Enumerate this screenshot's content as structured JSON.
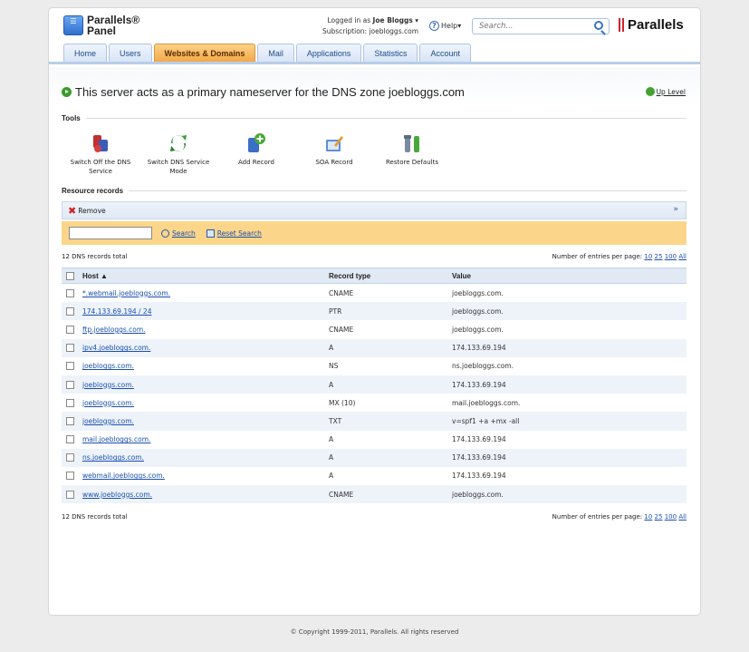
{
  "header": {
    "logo_line1": "Parallels®",
    "logo_line2": "Panel",
    "logged_in_prefix": "Logged in as",
    "user": "Joe Bloggs",
    "subscription": "Subscription: joebloggs.com",
    "help_label": "Help",
    "search_placeholder": "Search...",
    "brand": "Parallels"
  },
  "tabs": [
    {
      "label": "Home"
    },
    {
      "label": "Users"
    },
    {
      "label": "Websites & Domains"
    },
    {
      "label": "Mail"
    },
    {
      "label": "Applications"
    },
    {
      "label": "Statistics"
    },
    {
      "label": "Account"
    }
  ],
  "page": {
    "title": "This server acts as a primary nameserver for the DNS zone joebloggs.com",
    "up_level": "Up Level"
  },
  "tools": {
    "section_label": "Tools",
    "items": [
      {
        "label": "Switch Off the DNS Service",
        "icon": "switch-off-dns-icon"
      },
      {
        "label": "Switch DNS Service Mode",
        "icon": "switch-mode-icon"
      },
      {
        "label": "Add Record",
        "icon": "add-record-icon"
      },
      {
        "label": "SOA Record",
        "icon": "soa-record-icon"
      },
      {
        "label": "Restore Defaults",
        "icon": "restore-defaults-icon"
      }
    ]
  },
  "records": {
    "section_label": "Resource records",
    "remove_label": "Remove",
    "search_label": "Search",
    "reset_search_label": "Reset Search",
    "total": "12 DNS records total",
    "entries_label": "Number of entries per page:",
    "page_sizes": [
      "10",
      "25",
      "100",
      "All"
    ],
    "columns": {
      "host": "Host ▲",
      "type": "Record type",
      "value": "Value"
    },
    "rows": [
      {
        "host": "*.webmail.joebloggs.com.",
        "type": "CNAME",
        "value": "joebloggs.com."
      },
      {
        "host": "174.133.69.194 / 24",
        "type": "PTR",
        "value": "joebloggs.com."
      },
      {
        "host": "ftp.joebloggs.com.",
        "type": "CNAME",
        "value": "joebloggs.com."
      },
      {
        "host": "ipv4.joebloggs.com.",
        "type": "A",
        "value": "174.133.69.194"
      },
      {
        "host": "joebloggs.com.",
        "type": "NS",
        "value": "ns.joebloggs.com."
      },
      {
        "host": "joebloggs.com.",
        "type": "A",
        "value": "174.133.69.194"
      },
      {
        "host": "joebloggs.com.",
        "type": "MX (10)",
        "value": "mail.joebloggs.com."
      },
      {
        "host": "joebloggs.com.",
        "type": "TXT",
        "value": "v=spf1 +a +mx -all"
      },
      {
        "host": "mail.joebloggs.com.",
        "type": "A",
        "value": "174.133.69.194"
      },
      {
        "host": "ns.joebloggs.com.",
        "type": "A",
        "value": "174.133.69.194"
      },
      {
        "host": "webmail.joebloggs.com.",
        "type": "A",
        "value": "174.133.69.194"
      },
      {
        "host": "www.joebloggs.com.",
        "type": "CNAME",
        "value": "joebloggs.com."
      }
    ]
  },
  "footer": {
    "copyright": "© Copyright 1999-2011, Parallels. All rights reserved"
  },
  "colors": {
    "active_tab": "#f3a945",
    "filter_bar": "#fbd58a",
    "link": "#1a4fb0",
    "brand_red": "#d0242b"
  }
}
